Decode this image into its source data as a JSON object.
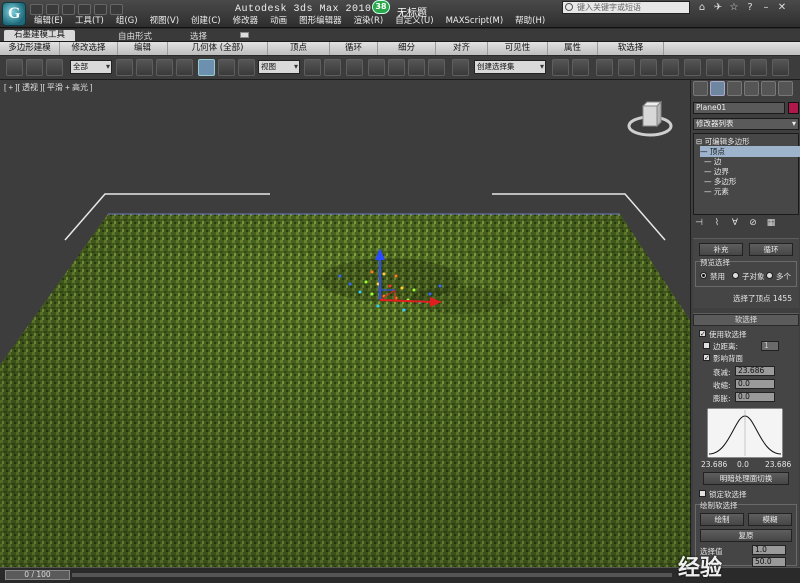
{
  "titlebar": {
    "app_title": "Autodesk 3ds Max  2010 S",
    "badge": "38",
    "document": "无标题",
    "search_placeholder": "键入关键字或短语"
  },
  "menu": [
    "编辑(E)",
    "工具(T)",
    "组(G)",
    "视图(V)",
    "创建(C)",
    "修改器",
    "动画",
    "图形编辑器",
    "渲染(R)",
    "自定义(U)",
    "MAXScript(M)",
    "帮助(H)"
  ],
  "ribbon": {
    "tabs": [
      "石墨建模工具",
      "自由形式",
      "选择"
    ],
    "row": [
      "多边形建模",
      "修改选择",
      "编辑",
      "几何体 (全部)",
      "顶点",
      "循环",
      "细分",
      "对齐",
      "可见性",
      "属性",
      "软选择"
    ]
  },
  "toolbar": {
    "filter": "全部",
    "refcoord": "视图",
    "selset": "创建选择集"
  },
  "viewport": {
    "label": "[ + ][ 透视 ][ 平滑 + 高光 ]"
  },
  "panel": {
    "object_name": "Plane01",
    "modifier_list": "修改器列表",
    "stack": [
      "可编辑多边形",
      "顶点",
      "边",
      "边界",
      "多边形",
      "元素"
    ],
    "select_top": [
      "补充",
      "循环"
    ],
    "preview_title": "预览选择",
    "preview_options": [
      "禁用",
      "子对象",
      "多个"
    ],
    "selected_text": "选择了顶点 1455",
    "soft_title": "软选择",
    "use_soft": "使用软选择",
    "edge_dist": "边距离:",
    "edge_dist_val": "1",
    "affect_back": "影响背面",
    "falloff_label": "衰减:",
    "falloff_val": "23.686",
    "pinch_label": "收缩:",
    "pinch_val": "0.0",
    "bubble_label": "膨胀:",
    "bubble_val": "0.0",
    "curve_axis": [
      "23.686",
      "0.0",
      "23.686"
    ],
    "shaded_face": "明暗处理面切换",
    "lock_soft": "锁定软选择",
    "paint_title": "绘制软选择",
    "paint_btn": "绘制",
    "blur_btn": "模糊",
    "revert_btn": "复原",
    "select_value_label": "选择值",
    "select_value": "1.0",
    "brush_size": "50.0"
  },
  "status": {
    "time": "0 / 100"
  },
  "watermark": "经验"
}
